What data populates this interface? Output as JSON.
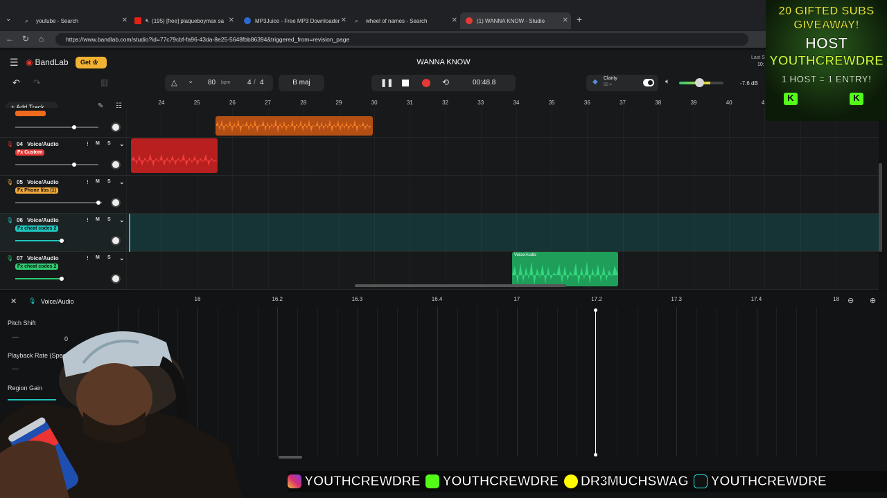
{
  "browser": {
    "tabs": [
      {
        "title": "youtube - Search",
        "color": "#5b8bd9"
      },
      {
        "title": "(195) [free] plaqueboymax sa",
        "color": "#e62117"
      },
      {
        "title": "MP3Juice - Free MP3 Downloader",
        "color": "#2a6bd1"
      },
      {
        "title": "wheel of names - Search",
        "color": "#5b8bd9"
      },
      {
        "title": "(1) WANNA KNOW - Studio",
        "color": "#e53935"
      }
    ],
    "url": "https://www.bandlab.com/studio?id=77c79cbf-fa96-43da-8e25-5648fbb86394&triggered_from=revision_page"
  },
  "app": {
    "brand": "BandLab",
    "get_label": "Get",
    "song_title": "WANNA KNOW",
    "bpm": "80",
    "bpm_unit": "bpm",
    "time_sig_num": "4",
    "time_sig_sep": "/",
    "time_sig_den": "4",
    "key": "B maj",
    "time": "00:48.8",
    "clarity_label": "Clarity",
    "clarity_sub": "50 >",
    "volume_db": "-7.6 dB",
    "last_saved_label": "Last S",
    "last_saved_time": "10:",
    "volume_level": 0.4
  },
  "timeline": {
    "add_track_label": "Add Track",
    "bars": [
      "24",
      "25",
      "26",
      "27",
      "28",
      "29",
      "30",
      "31",
      "32",
      "33",
      "34",
      "35",
      "36",
      "37",
      "38",
      "39",
      "40",
      "4"
    ]
  },
  "tracks": [
    {
      "num": "04",
      "type": "Voice/Audio",
      "fx": "Fx Custom",
      "fx_color": "#e53935",
      "fader": 0.5
    },
    {
      "num": "05",
      "type": "Voice/Audio",
      "fx": "Fx Phone libs (1)",
      "fx_color": "#f2a93b",
      "fader": 0.73
    },
    {
      "num": "06",
      "type": "Voice/Audio",
      "fx": "Fx cheat codes 2",
      "fx_color": "#1fc7c0",
      "fader": 0.4
    },
    {
      "num": "07",
      "type": "Voice/Audio",
      "fx": "Fx cheat codes 2",
      "fx_color": "#2ecc71",
      "fader": 0.39
    }
  ],
  "track_buttons": {
    "mute": "M",
    "solo": "S",
    "more": "⋮"
  },
  "region_label": "Voice/Audio",
  "editor": {
    "title": "Voice/Audio",
    "ticks": [
      "16",
      "16.2",
      "16.3",
      "16.4",
      "17",
      "17.2",
      "17.3",
      "17.4",
      "18"
    ],
    "pitch_shift_label": "Pitch Shift",
    "pitch_value": "0",
    "playback_rate_label": "Playback Rate (Spee",
    "region_gain_label": "Region Gain"
  },
  "promo": {
    "line1": "20 GIFTED SUBS",
    "line2": "GIVEAWAY!",
    "line3": "HOST",
    "line4": "YOUTHCREWDRE",
    "line5": "1 HOST = 1 ENTRY!"
  },
  "socials": [
    {
      "handle": "YOUTHCREWDRE",
      "icon": "instagram-icon",
      "color": "#d6306f"
    },
    {
      "handle": "YOUTHCREWDRE",
      "icon": "kick-icon",
      "color": "#53fc18"
    },
    {
      "handle": "DR3MUCHSWAG",
      "icon": "snapchat-icon",
      "color": "#fffc00"
    },
    {
      "handle": "YOUTHCREWDRE",
      "icon": "tiktok-icon",
      "color": "#111111"
    }
  ]
}
